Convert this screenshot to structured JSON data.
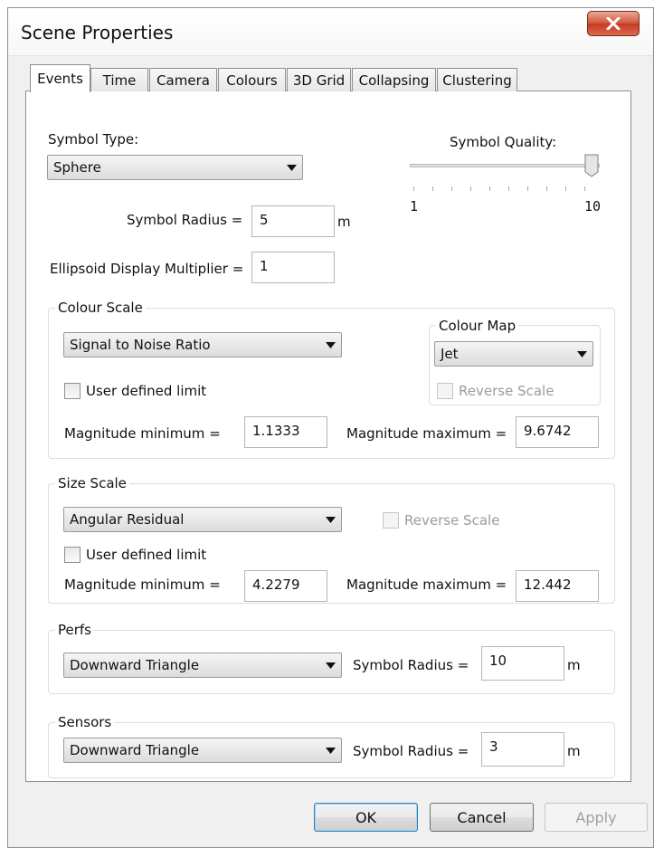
{
  "window": {
    "title": "Scene Properties"
  },
  "tabs": [
    {
      "label": "Events",
      "active": true
    },
    {
      "label": "Time",
      "active": false
    },
    {
      "label": "Camera",
      "active": false
    },
    {
      "label": "Colours",
      "active": false
    },
    {
      "label": "3D Grid",
      "active": false
    },
    {
      "label": "Collapsing",
      "active": false
    },
    {
      "label": "Clustering",
      "active": false
    }
  ],
  "events": {
    "symbol_type": {
      "label": "Symbol Type:",
      "value": "Sphere"
    },
    "symbol_quality": {
      "label": "Symbol Quality:",
      "min_label": "1",
      "max_label": "10",
      "value": 10,
      "min": 1,
      "max": 10
    },
    "symbol_radius": {
      "label": "Symbol Radius =",
      "value": "5",
      "unit": "m"
    },
    "ellipsoid_multiplier": {
      "label": "Ellipsoid Display Multiplier =",
      "value": "1"
    },
    "colour_scale": {
      "title": "Colour Scale",
      "value": "Signal to Noise Ratio",
      "user_defined_limit": {
        "label": "User defined limit",
        "checked": false
      },
      "min_label": "Magnitude minimum =",
      "min_value": "1.1333",
      "max_label": "Magnitude maximum =",
      "max_value": "9.6742",
      "colour_map": {
        "title": "Colour Map",
        "value": "Jet",
        "reverse": {
          "label": "Reverse Scale",
          "checked": false,
          "enabled": false
        }
      }
    },
    "size_scale": {
      "title": "Size Scale",
      "value": "Angular Residual",
      "reverse": {
        "label": "Reverse Scale",
        "checked": false,
        "enabled": false
      },
      "user_defined_limit": {
        "label": "User defined limit",
        "checked": false
      },
      "min_label": "Magnitude minimum =",
      "min_value": "4.2279",
      "max_label": "Magnitude maximum =",
      "max_value": "12.442"
    },
    "perfs": {
      "title": "Perfs",
      "symbol": "Downward Triangle",
      "radius_label": "Symbol Radius =",
      "radius_value": "10",
      "unit": "m"
    },
    "sensors": {
      "title": "Sensors",
      "symbol": "Downward Triangle",
      "radius_label": "Symbol Radius =",
      "radius_value": "3",
      "unit": "m"
    }
  },
  "buttons": {
    "ok": "OK",
    "cancel": "Cancel",
    "apply": "Apply"
  },
  "icons": {
    "close": "close-icon",
    "dropdown": "chevron-down-icon"
  },
  "colors": {
    "close_button": "#c53b21",
    "default_button_border": "#3c7fb1",
    "panel_bg": "#f0f0f0"
  }
}
